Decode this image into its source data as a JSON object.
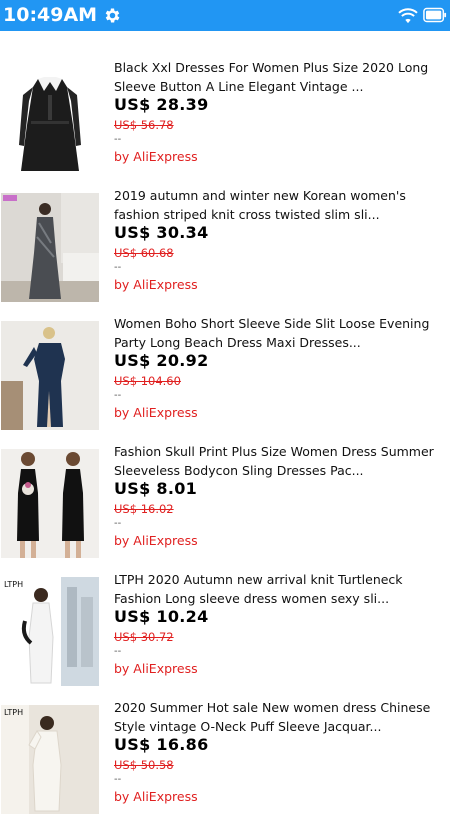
{
  "status_bar": {
    "time": "10:49AM",
    "colors": {
      "background": "#2196f3",
      "text": "#ffffff"
    },
    "icons": [
      "gear-icon",
      "wifi-icon",
      "battery-icon"
    ]
  },
  "products": [
    {
      "title": "Black Xxl Dresses For Women Plus Size 2020 Long Sleeve Button A Line Elegant Vintage ...",
      "price": "US$ 28.39",
      "original_price": "US$ 56.78",
      "separator": "--",
      "source": "by AliExpress"
    },
    {
      "title": "2019 autumn and winter new Korean women's fashion striped knit cross twisted slim sli...",
      "price": "US$ 30.34",
      "original_price": "US$ 60.68",
      "separator": "--",
      "source": "by AliExpress"
    },
    {
      "title": "Women Boho Short Sleeve Side Slit Loose Evening Party Long Beach Dress Maxi Dresses...",
      "price": "US$ 20.92",
      "original_price": "US$ 104.60",
      "separator": "--",
      "source": "by AliExpress"
    },
    {
      "title": "Fashion Skull Print Plus Size Women Dress Summer Sleeveless Bodycon Sling Dresses Pac...",
      "price": "US$ 8.01",
      "original_price": "US$ 16.02",
      "separator": "--",
      "source": "by AliExpress"
    },
    {
      "title": "LTPH 2020 Autumn new arrival knit Turtleneck Fashion Long sleeve dress women sexy sli...",
      "price": "US$ 10.24",
      "original_price": "US$ 30.72",
      "separator": "--",
      "source": "by AliExpress"
    },
    {
      "title": "2020 Summer Hot sale New women dress Chinese Style vintage O-Neck Puff Sleeve Jacquar...",
      "price": "US$ 16.86",
      "original_price": "US$ 50.58",
      "separator": "--",
      "source": "by AliExpress"
    }
  ],
  "thumb_logos": [
    "LTPH",
    "LTPH"
  ],
  "colors": {
    "sale_red": "#e02020",
    "price_text": "#000000"
  }
}
